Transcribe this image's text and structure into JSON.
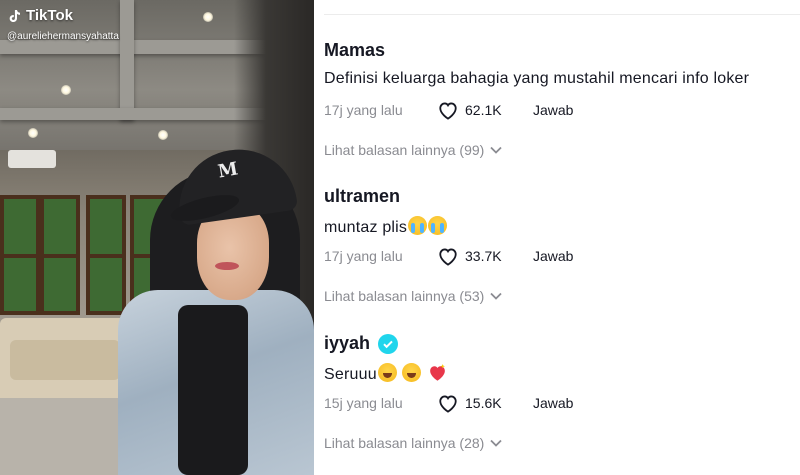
{
  "video": {
    "brand": "TikTok",
    "handle": "@aureliehermansyahatta",
    "cap_logo": "M"
  },
  "comments": [
    {
      "user": "Mamas",
      "verified": false,
      "text": "Definisi keluarga bahagia yang mustahil mencari info loker",
      "time": "17j yang lalu",
      "likes": "62.1K",
      "reply": "Jawab",
      "more": "Lihat balasan lainnya (99)"
    },
    {
      "user": "ultramen",
      "verified": false,
      "text": "muntaz plis",
      "emojis": [
        "loudly-crying-face",
        "loudly-crying-face"
      ],
      "time": "17j yang lalu",
      "likes": "33.7K",
      "reply": "Jawab",
      "more": "Lihat balasan lainnya (53)"
    },
    {
      "user": "iyyah",
      "verified": true,
      "text": "Seruuu",
      "emojis": [
        "grinning-squinting-face",
        "grinning-squinting-face",
        "sparkling-heart"
      ],
      "time": "15j yang lalu",
      "likes": "15.6K",
      "reply": "Jawab",
      "more": "Lihat balasan lainnya (28)"
    }
  ],
  "colors": {
    "text": "#161823",
    "muted": "#8a8b91",
    "verified": "#20d5ec"
  }
}
